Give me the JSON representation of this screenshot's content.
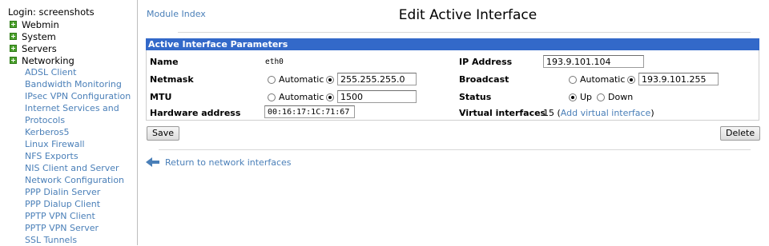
{
  "sidebar": {
    "login": "Login: screenshots",
    "categories": [
      "Webmin",
      "System",
      "Servers",
      "Networking"
    ],
    "modules": [
      "ADSL Client",
      "Bandwidth Monitoring",
      "IPsec VPN Configuration",
      "Internet Services and Protocols",
      "Kerberos5",
      "Linux Firewall",
      "NFS Exports",
      "NIS Client and Server",
      "Network Configuration",
      "PPP Dialin Server",
      "PPP Dialup Client",
      "PPTP VPN Client",
      "PPTP VPN Server",
      "SSL Tunnels"
    ]
  },
  "header": {
    "module_index": "Module Index",
    "title": "Edit Active Interface"
  },
  "panel": {
    "title": "Active Interface Parameters",
    "name_label": "Name",
    "name_value": "eth0",
    "ip_label": "IP Address",
    "ip_value": "193.9.101.104",
    "netmask_label": "Netmask",
    "netmask_value": "255.255.255.0",
    "broadcast_label": "Broadcast",
    "broadcast_value": "193.9.101.255",
    "mtu_label": "MTU",
    "mtu_value": "1500",
    "status_label": "Status",
    "hw_label": "Hardware address",
    "hw_value": "00:16:17:1C:71:67",
    "virtual_label": "Virtual interfaces",
    "virtual_count": "15",
    "virtual_link": "Add virtual interface",
    "automatic": "Automatic",
    "up": "Up",
    "down": "Down"
  },
  "buttons": {
    "save": "Save",
    "delete": "Delete"
  },
  "footer": {
    "back_link": "Return to network interfaces"
  },
  "colors": {
    "panel_header": "#3369c9",
    "link": "#4a7fb8",
    "category_icon": "#4aa02c"
  }
}
